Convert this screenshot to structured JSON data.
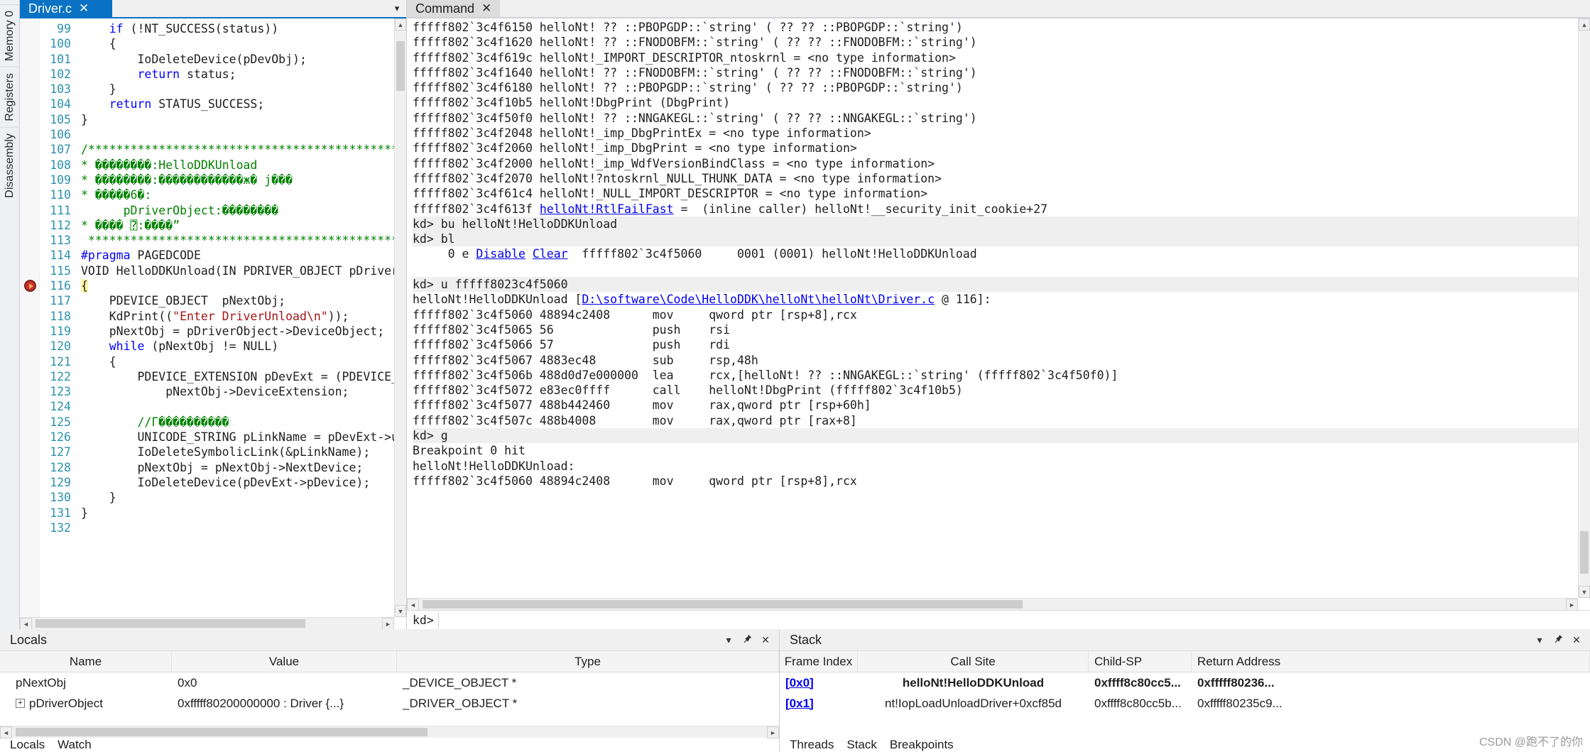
{
  "left_dock": {
    "items": [
      {
        "label": "Disassembly",
        "name": "disassembly"
      },
      {
        "label": "Registers",
        "name": "registers"
      },
      {
        "label": "Memory 0",
        "name": "memory-0"
      }
    ]
  },
  "editor": {
    "tab_label": "Driver.c",
    "close_glyph": "✕",
    "chevron_glyph": "▾",
    "lines": [
      {
        "n": "99",
        "segs": [
          {
            "t": "    ",
            "c": ""
          },
          {
            "t": "if",
            "c": "kw"
          },
          {
            "t": " (!NT_SUCCESS(status))",
            "c": ""
          }
        ]
      },
      {
        "n": "100",
        "segs": [
          {
            "t": "    {",
            "c": ""
          }
        ]
      },
      {
        "n": "101",
        "segs": [
          {
            "t": "        IoDeleteDevice(pDevObj);",
            "c": ""
          }
        ]
      },
      {
        "n": "102",
        "segs": [
          {
            "t": "        ",
            "c": ""
          },
          {
            "t": "return",
            "c": "kw"
          },
          {
            "t": " status;",
            "c": ""
          }
        ]
      },
      {
        "n": "103",
        "segs": [
          {
            "t": "    }",
            "c": ""
          }
        ]
      },
      {
        "n": "104",
        "segs": [
          {
            "t": "    ",
            "c": ""
          },
          {
            "t": "return",
            "c": "kw"
          },
          {
            "t": " STATUS_SUCCESS;",
            "c": ""
          }
        ]
      },
      {
        "n": "105",
        "segs": [
          {
            "t": "}",
            "c": ""
          }
        ]
      },
      {
        "n": "106",
        "segs": [
          {
            "t": "",
            "c": ""
          }
        ]
      },
      {
        "n": "107",
        "segs": [
          {
            "t": "/*********************************************",
            "c": "cmt"
          }
        ]
      },
      {
        "n": "108",
        "segs": [
          {
            "t": "* ",
            "c": "cmt"
          },
          {
            "t": "��������",
            "c": "gl"
          },
          {
            "t": ":HelloDDKUnload",
            "c": "cmt"
          }
        ]
      },
      {
        "n": "109",
        "segs": [
          {
            "t": "* ",
            "c": "cmt"
          },
          {
            "t": "��������",
            "c": "gl"
          },
          {
            "t": ":",
            "c": "cmt"
          },
          {
            "t": "������������ж� j���",
            "c": "gl"
          }
        ]
      },
      {
        "n": "110",
        "segs": [
          {
            "t": "* ",
            "c": "cmt"
          },
          {
            "t": "�����6�",
            "c": "gl"
          },
          {
            "t": ":",
            "c": "cmt"
          }
        ]
      },
      {
        "n": "111",
        "segs": [
          {
            "t": "      pDriverObject:",
            "c": "cmt"
          },
          {
            "t": "��������",
            "c": "gl"
          }
        ]
      },
      {
        "n": "112",
        "segs": [
          {
            "t": "* ",
            "c": "cmt"
          },
          {
            "t": "����",
            "c": "gl"
          },
          {
            "t": " ⍰:",
            "c": "cmt"
          },
          {
            "t": "����",
            "c": "gl"
          },
          {
            "t": "”",
            "c": "cmt"
          }
        ]
      },
      {
        "n": "113",
        "segs": [
          {
            "t": " *********************************************",
            "c": "cmt"
          }
        ]
      },
      {
        "n": "114",
        "segs": [
          {
            "t": "#pragma",
            "c": "kw"
          },
          {
            "t": " PAGEDCODE",
            "c": ""
          }
        ]
      },
      {
        "n": "115",
        "segs": [
          {
            "t": "VOID HelloDDKUnload(IN PDRIVER_OBJECT pDriverObject)",
            "c": ""
          }
        ]
      },
      {
        "n": "116",
        "segs": [
          {
            "t": "{",
            "c": "hl"
          }
        ],
        "breakpoint": true
      },
      {
        "n": "117",
        "segs": [
          {
            "t": "    PDEVICE_OBJECT  pNextObj;",
            "c": ""
          }
        ]
      },
      {
        "n": "118",
        "segs": [
          {
            "t": "    KdPrint((",
            "c": ""
          },
          {
            "t": "\"Enter DriverUnload\\n\"",
            "c": "str"
          },
          {
            "t": "));",
            "c": ""
          }
        ]
      },
      {
        "n": "119",
        "segs": [
          {
            "t": "    pNextObj = pDriverObject->DeviceObject;",
            "c": ""
          }
        ]
      },
      {
        "n": "120",
        "segs": [
          {
            "t": "    ",
            "c": ""
          },
          {
            "t": "while",
            "c": "kw"
          },
          {
            "t": " (pNextObj != NULL)",
            "c": ""
          }
        ]
      },
      {
        "n": "121",
        "segs": [
          {
            "t": "    {",
            "c": ""
          }
        ]
      },
      {
        "n": "122",
        "segs": [
          {
            "t": "        PDEVICE_EXTENSION pDevExt = (PDEVICE_EXTENSION)",
            "c": ""
          }
        ]
      },
      {
        "n": "123",
        "segs": [
          {
            "t": "            pNextObj->DeviceExtension;",
            "c": ""
          }
        ]
      },
      {
        "n": "124",
        "segs": [
          {
            "t": "",
            "c": ""
          }
        ]
      },
      {
        "n": "125",
        "segs": [
          {
            "t": "        //Γ",
            "c": "cmt"
          },
          {
            "t": "����������",
            "c": "gl"
          }
        ]
      },
      {
        "n": "126",
        "segs": [
          {
            "t": "        UNICODE_STRING pLinkName = pDevExt->ustrSymLinkName;",
            "c": ""
          }
        ]
      },
      {
        "n": "127",
        "segs": [
          {
            "t": "        IoDeleteSymbolicLink(&pLinkName);",
            "c": ""
          }
        ]
      },
      {
        "n": "128",
        "segs": [
          {
            "t": "        pNextObj = pNextObj->NextDevice;",
            "c": ""
          }
        ]
      },
      {
        "n": "129",
        "segs": [
          {
            "t": "        IoDeleteDevice(pDevExt->pDevice);",
            "c": ""
          }
        ]
      },
      {
        "n": "130",
        "segs": [
          {
            "t": "    }",
            "c": ""
          }
        ]
      },
      {
        "n": "131",
        "segs": [
          {
            "t": "}",
            "c": ""
          }
        ]
      },
      {
        "n": "132",
        "segs": [
          {
            "t": "",
            "c": ""
          }
        ]
      }
    ]
  },
  "command": {
    "tab_label": "Command",
    "close_glyph": "✕",
    "prompt_label": "kd>",
    "input_value": "",
    "input_placeholder": "",
    "lines": [
      {
        "segs": [
          {
            "t": "fffff802`3c4f6150 helloNt! ?? ::PBOPGDP::`string' ( ?? ?? ::PBOPGDP::`string')",
            "c": ""
          }
        ]
      },
      {
        "segs": [
          {
            "t": "fffff802`3c4f1620 helloNt! ?? ::FNODOBFM::`string' ( ?? ?? ::FNODOBFM::`string')",
            "c": ""
          }
        ]
      },
      {
        "segs": [
          {
            "t": "fffff802`3c4f619c helloNt!_IMPORT_DESCRIPTOR_ntoskrnl = <no type information>",
            "c": ""
          }
        ]
      },
      {
        "segs": [
          {
            "t": "fffff802`3c4f1640 helloNt! ?? ::FNODOBFM::`string' ( ?? ?? ::FNODOBFM::`string')",
            "c": ""
          }
        ]
      },
      {
        "segs": [
          {
            "t": "fffff802`3c4f6180 helloNt! ?? ::PBOPGDP::`string' ( ?? ?? ::PBOPGDP::`string')",
            "c": ""
          }
        ]
      },
      {
        "segs": [
          {
            "t": "fffff802`3c4f10b5 helloNt!DbgPrint (DbgPrint)",
            "c": ""
          }
        ]
      },
      {
        "segs": [
          {
            "t": "fffff802`3c4f50f0 helloNt! ?? ::NNGAKEGL::`string' ( ?? ?? ::NNGAKEGL::`string')",
            "c": ""
          }
        ]
      },
      {
        "segs": [
          {
            "t": "fffff802`3c4f2048 helloNt!_imp_DbgPrintEx = <no type information>",
            "c": ""
          }
        ]
      },
      {
        "segs": [
          {
            "t": "fffff802`3c4f2060 helloNt!_imp_DbgPrint = <no type information>",
            "c": ""
          }
        ]
      },
      {
        "segs": [
          {
            "t": "fffff802`3c4f2000 helloNt!_imp_WdfVersionBindClass = <no type information>",
            "c": ""
          }
        ]
      },
      {
        "segs": [
          {
            "t": "fffff802`3c4f2070 helloNt!?ntoskrnl_NULL_THUNK_DATA = <no type information>",
            "c": ""
          }
        ]
      },
      {
        "segs": [
          {
            "t": "fffff802`3c4f61c4 helloNt!_NULL_IMPORT_DESCRIPTOR = <no type information>",
            "c": ""
          }
        ]
      },
      {
        "segs": [
          {
            "t": "fffff802`3c4f613f ",
            "c": ""
          },
          {
            "t": "helloNt!RtlFailFast",
            "c": "lnk"
          },
          {
            "t": " =  (inline caller) helloNt!__security_init_cookie+27",
            "c": ""
          }
        ]
      },
      {
        "prompt": true,
        "segs": [
          {
            "t": "kd> bu helloNt!HelloDDKUnload",
            "c": ""
          }
        ]
      },
      {
        "prompt": true,
        "segs": [
          {
            "t": "kd> bl",
            "c": ""
          }
        ]
      },
      {
        "segs": [
          {
            "t": "     0 e ",
            "c": ""
          },
          {
            "t": "Disable",
            "c": "lnk"
          },
          {
            "t": " ",
            "c": ""
          },
          {
            "t": "Clear",
            "c": "lnk"
          },
          {
            "t": "  fffff802`3c4f5060     0001 (0001) helloNt!HelloDDKUnload",
            "c": ""
          }
        ]
      },
      {
        "segs": [
          {
            "t": "",
            "c": ""
          }
        ]
      },
      {
        "prompt": true,
        "segs": [
          {
            "t": "kd> u fffff8023c4f5060",
            "c": ""
          }
        ]
      },
      {
        "segs": [
          {
            "t": "helloNt!HelloDDKUnload [",
            "c": ""
          },
          {
            "t": "D:\\software\\Code\\HelloDDK\\helloNt\\helloNt\\Driver.c",
            "c": "lnk"
          },
          {
            "t": " @ 116]:",
            "c": ""
          }
        ]
      },
      {
        "segs": [
          {
            "t": "fffff802`3c4f5060 48894c2408      mov     qword ptr [rsp+8],rcx",
            "c": ""
          }
        ]
      },
      {
        "segs": [
          {
            "t": "fffff802`3c4f5065 56              push    rsi",
            "c": ""
          }
        ]
      },
      {
        "segs": [
          {
            "t": "fffff802`3c4f5066 57              push    rdi",
            "c": ""
          }
        ]
      },
      {
        "segs": [
          {
            "t": "fffff802`3c4f5067 4883ec48        sub     rsp,48h",
            "c": ""
          }
        ]
      },
      {
        "segs": [
          {
            "t": "fffff802`3c4f506b 488d0d7e000000  lea     rcx,[helloNt! ?? ::NNGAKEGL::`string' (fffff802`3c4f50f0)]",
            "c": ""
          }
        ]
      },
      {
        "segs": [
          {
            "t": "fffff802`3c4f5072 e83ec0ffff      call    helloNt!DbgPrint (fffff802`3c4f10b5)",
            "c": ""
          }
        ]
      },
      {
        "segs": [
          {
            "t": "fffff802`3c4f5077 488b442460      mov     rax,qword ptr [rsp+60h]",
            "c": ""
          }
        ]
      },
      {
        "segs": [
          {
            "t": "fffff802`3c4f507c 488b4008        mov     rax,qword ptr [rax+8]",
            "c": ""
          }
        ]
      },
      {
        "prompt": true,
        "segs": [
          {
            "t": "kd> g",
            "c": ""
          }
        ]
      },
      {
        "segs": [
          {
            "t": "Breakpoint 0 hit",
            "c": ""
          }
        ]
      },
      {
        "segs": [
          {
            "t": "helloNt!HelloDDKUnload:",
            "c": ""
          }
        ]
      },
      {
        "segs": [
          {
            "t": "fffff802`3c4f5060 48894c2408      mov     qword ptr [rsp+8],rcx",
            "c": ""
          }
        ]
      }
    ]
  },
  "locals": {
    "title": "Locals",
    "columns": [
      "Name",
      "Value",
      "Type"
    ],
    "rows": [
      {
        "expandable": false,
        "name": "pNextObj",
        "value": "0x0",
        "type": "_DEVICE_OBJECT *"
      },
      {
        "expandable": true,
        "name": "pDriverObject",
        "value": "0xfffff80200000000 : Driver {...}",
        "type": "_DRIVER_OBJECT *"
      }
    ],
    "status_tabs": [
      "Locals",
      "Watch"
    ]
  },
  "stack": {
    "title": "Stack",
    "columns": [
      "Frame Index",
      "Call Site",
      "Child-SP",
      "Return Address"
    ],
    "rows": [
      {
        "frame": "[0x0]",
        "call_site": "helloNt!HelloDDKUnload",
        "child_sp": "0xffff8c80cc5...",
        "return_address": "0xfffff80236...",
        "bold": true
      },
      {
        "frame": "[0x1]",
        "call_site": "nt!IopLoadUnloadDriver+0xcf85d",
        "child_sp": "0xffff8c80cc5b...",
        "return_address": "0xfffff80235c9..."
      }
    ],
    "status_tabs": [
      "Threads",
      "Stack",
      "Breakpoints"
    ]
  },
  "icons": {
    "pin": "📌",
    "close": "✕",
    "chevron_down": "▾",
    "arrow_up": "▲",
    "arrow_down": "▼",
    "arrow_left": "◄",
    "arrow_right": "►",
    "plus": "+"
  },
  "watermark": "CSDN @跑不了的你"
}
